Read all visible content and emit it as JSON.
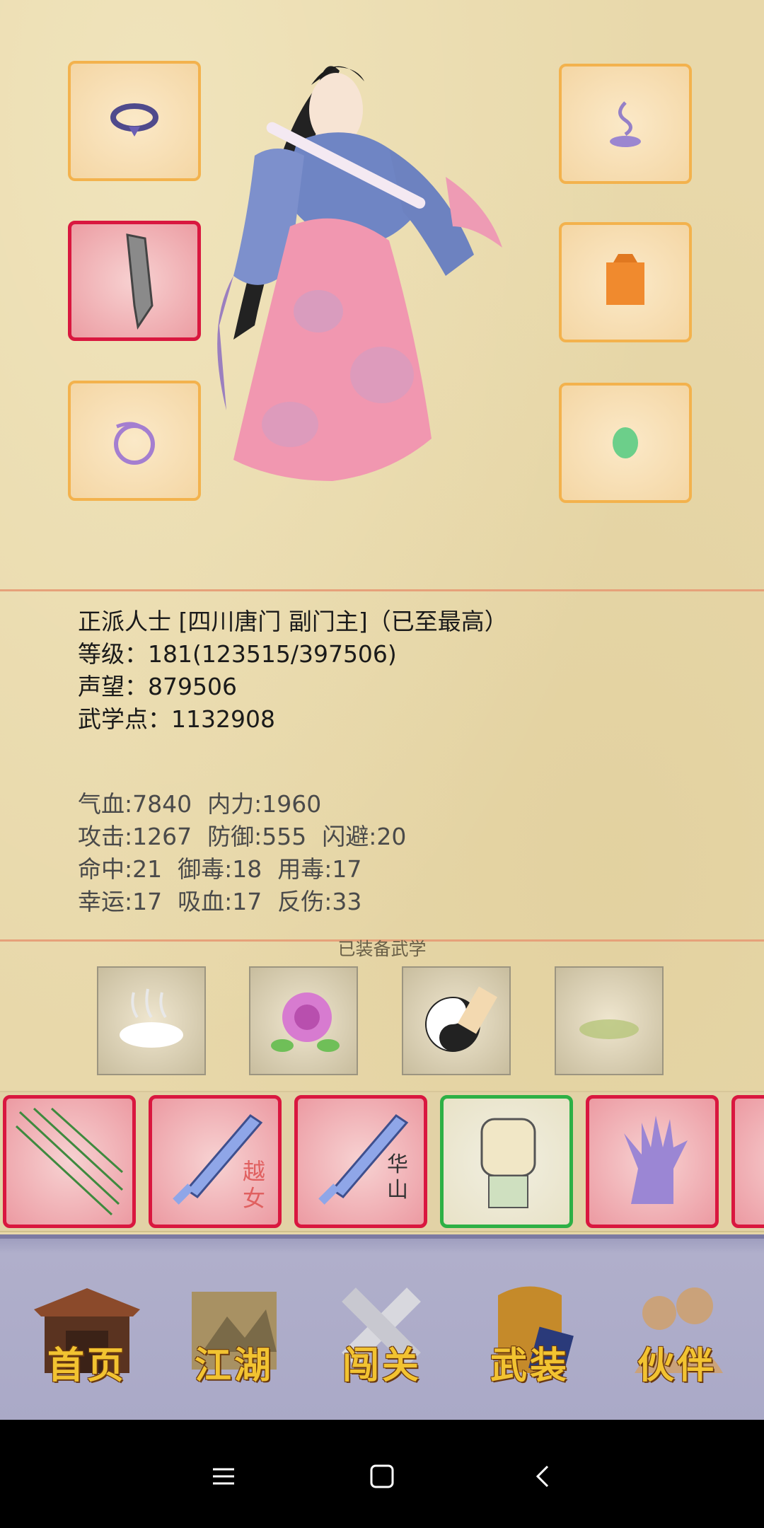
{
  "character": {
    "title_line": "正派人士 [四川唐门 副门主]（已至最高）",
    "level_line": "等级：181(123515/397506)",
    "reputation_line": "声望：879506",
    "martial_points_line": "武学点：1132908"
  },
  "stats": {
    "hp": "气血:7840",
    "inner": "内力:1960",
    "attack": "攻击:1267",
    "defense": "防御:555",
    "dodge": "闪避:20",
    "hit": "命中:21",
    "poison_resist": "御毒:18",
    "poison_use": "用毒:17",
    "luck": "幸运:17",
    "lifesteal": "吸血:17",
    "reflect": "反伤:33"
  },
  "equipment_slots": [
    {
      "icon": "necklace-icon"
    },
    {
      "icon": "incense-icon"
    },
    {
      "icon": "weapon-icon"
    },
    {
      "icon": "armor-icon"
    },
    {
      "icon": "ring-icon"
    },
    {
      "icon": "jade-icon"
    }
  ],
  "martial": {
    "title": "已装备武学",
    "slots": [
      "cloud-icon",
      "rose-icon",
      "taichi-fist-icon",
      "grass-icon"
    ]
  },
  "skills": [
    {
      "icon": "needles-icon",
      "tag": ""
    },
    {
      "icon": "sword-icon",
      "tag": "越女"
    },
    {
      "icon": "sword-icon",
      "tag": "华山"
    },
    {
      "icon": "fist-icon",
      "tag": ""
    },
    {
      "icon": "claw-icon",
      "tag": ""
    }
  ],
  "nav": {
    "home": "首页",
    "jianghu": "江湖",
    "chuangguan": "闯关",
    "wuzhuang": "武装",
    "huoban": "伙伴"
  },
  "colors": {
    "slot_border": "#f3b24d",
    "selected_border": "#d9173f",
    "green_border": "#2db045",
    "nav_text": "#f2c331"
  }
}
